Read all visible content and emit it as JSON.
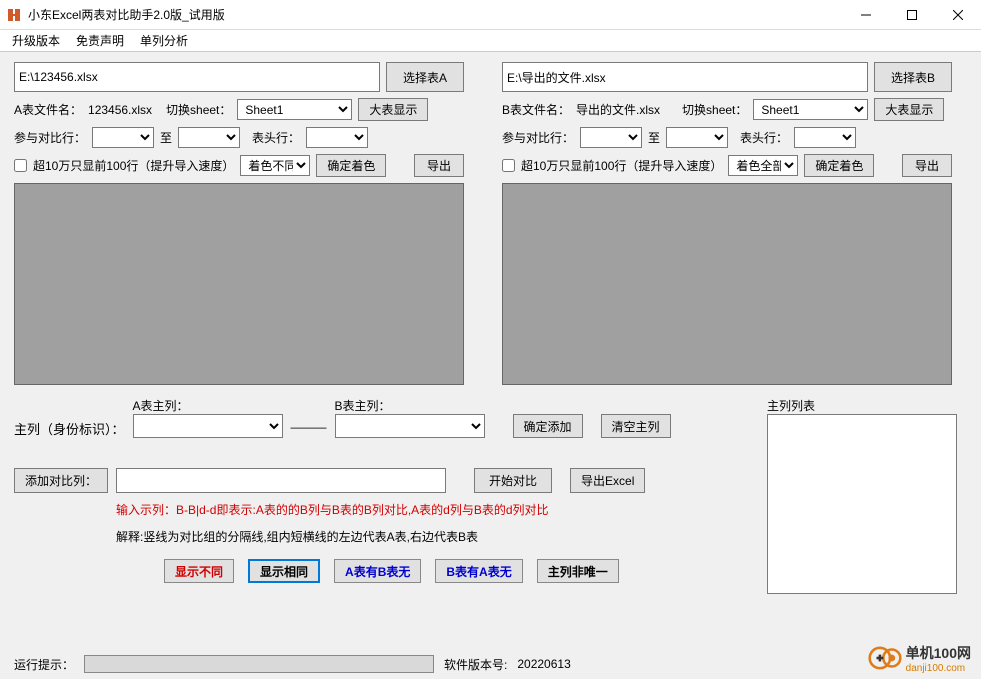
{
  "window": {
    "title": "小东Excel两表对比助手2.0版_试用版"
  },
  "menu": {
    "upgrade": "升级版本",
    "disclaimer": "免责声明",
    "single_col": "单列分析"
  },
  "panelA": {
    "path": "E:\\123456.xlsx",
    "select_table": "选择表A",
    "filename_lbl": "A表文件名：",
    "filename_val": "123456.xlsx",
    "switch_sheet": "切换sheet：",
    "sheet_sel": "Sheet1",
    "big_display": "大表显示",
    "compare_row_lbl": "参与对比行：",
    "to": "至",
    "header_row_lbl": "表头行：",
    "limit_chk": "超10万只显前100行（提升导入速度）",
    "color_sel": "着色不同",
    "confirm_color": "确定着色",
    "export": "导出"
  },
  "panelB": {
    "path": "E:\\导出的文件.xlsx",
    "select_table": "选择表B",
    "filename_lbl": "B表文件名：",
    "filename_val": "导出的文件.xlsx",
    "switch_sheet": "切换sheet：",
    "sheet_sel": "Sheet1",
    "big_display": "大表显示",
    "compare_row_lbl": "参与对比行：",
    "to": "至",
    "header_row_lbl": "表头行：",
    "limit_chk": "超10万只显前100行（提升导入速度）",
    "color_sel": "着色全部",
    "confirm_color": "确定着色",
    "export": "导出"
  },
  "keycol": {
    "a_label": "A表主列：",
    "b_label": "B表主列：",
    "main_label": "主列（身份标识）：",
    "dashes": "———",
    "confirm_add": "确定添加",
    "clear": "清空主列",
    "list_label": "主列列表"
  },
  "compare": {
    "add_col": "添加对比列：",
    "start": "开始对比",
    "export_excel": "导出Excel",
    "example_pre": "输入示列：",
    "example_body": "B-B|d-d即表示:A表的的B列与B表的B列对比,A表的d列与B表的d列对比",
    "explain_pre": "解释:",
    "explain_body": "竖线为对比组的分隔线,组内短横线的左边代表A表,右边代表B表"
  },
  "results": {
    "show_diff": "显示不同",
    "show_same": "显示相同",
    "a_has_b_not": "A表有B表无",
    "b_has_a_not": "B表有A表无",
    "key_not_unique": "主列非唯一"
  },
  "status": {
    "run_hint": "运行提示：",
    "version_lbl": "软件版本号:",
    "version_val": "20220613"
  },
  "watermark": {
    "cn": "单机100网",
    "en": "danji100.com"
  }
}
